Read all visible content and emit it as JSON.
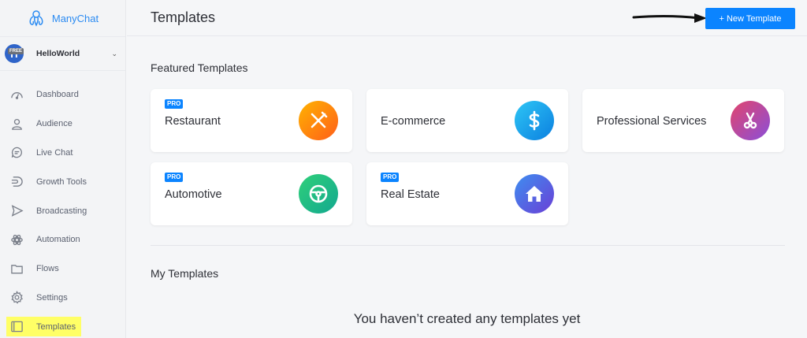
{
  "app": {
    "name": "ManyChat"
  },
  "account": {
    "initial": "H",
    "plan_badge": "FREE",
    "name": "HelloWorld"
  },
  "nav": [
    {
      "label": "Dashboard",
      "icon": "dashboard-icon"
    },
    {
      "label": "Audience",
      "icon": "audience-icon"
    },
    {
      "label": "Live Chat",
      "icon": "live-chat-icon"
    },
    {
      "label": "Growth Tools",
      "icon": "growth-tools-icon"
    },
    {
      "label": "Broadcasting",
      "icon": "broadcasting-icon"
    },
    {
      "label": "Automation",
      "icon": "automation-icon"
    },
    {
      "label": "Flows",
      "icon": "folder-icon"
    },
    {
      "label": "Settings",
      "icon": "gear-icon"
    },
    {
      "label": "Templates",
      "icon": "templates-icon",
      "active": true
    }
  ],
  "header": {
    "title": "Templates",
    "new_button": "+ New Template"
  },
  "featured": {
    "title": "Featured Templates",
    "cards": [
      {
        "label": "Restaurant",
        "pro": "PRO",
        "icon": "fork-knife-icon",
        "color": "#ff8a00"
      },
      {
        "label": "E-commerce",
        "pro": "",
        "icon": "dollar-icon",
        "color": "#1aa6ee"
      },
      {
        "label": "Professional Services",
        "pro": "",
        "icon": "scissors-icon",
        "color": "#c2418f"
      },
      {
        "label": "Automotive",
        "pro": "PRO",
        "icon": "steering-wheel-icon",
        "color": "#1fbf86"
      },
      {
        "label": "Real Estate",
        "pro": "PRO",
        "icon": "house-icon",
        "color": "#4a63e0"
      }
    ]
  },
  "my_templates": {
    "title": "My Templates",
    "empty_message": "You haven’t created any templates yet"
  },
  "colors": {
    "accent": "#0b84ff",
    "highlight": "#ffff66"
  }
}
